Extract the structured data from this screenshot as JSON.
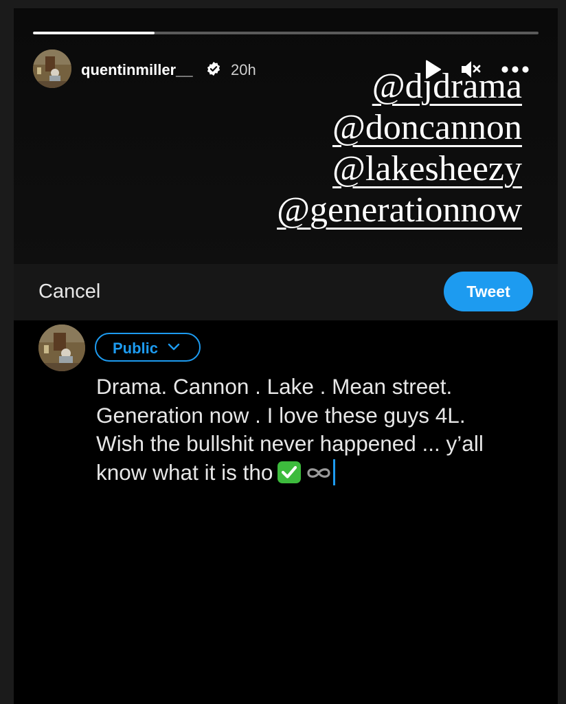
{
  "story": {
    "progress": 0.24,
    "username": "quentinmiller__",
    "time": "20h",
    "mentions": [
      "@djdrama",
      "@doncannon",
      "@lakesheezy",
      "@generationnow"
    ]
  },
  "compose": {
    "cancel_label": "Cancel",
    "tweet_label": "Tweet",
    "audience_label": "Public",
    "lines": [
      "Drama. Cannon . Lake . Mean street.",
      "Generation now . I love these guys 4L.",
      "Wish the bullshit never happened ... y’all",
      "know what it is tho"
    ]
  },
  "icons": {
    "verified": "verified-badge-icon",
    "play": "play-icon",
    "mute": "mute-icon",
    "more": "more-icon",
    "chevron": "chevron-down-icon",
    "check_emoji": "check-mark-emoji",
    "infinity_emoji": "infinity-emoji"
  },
  "colors": {
    "accent": "#1d9bf0",
    "check_green": "#3dbb3d"
  }
}
